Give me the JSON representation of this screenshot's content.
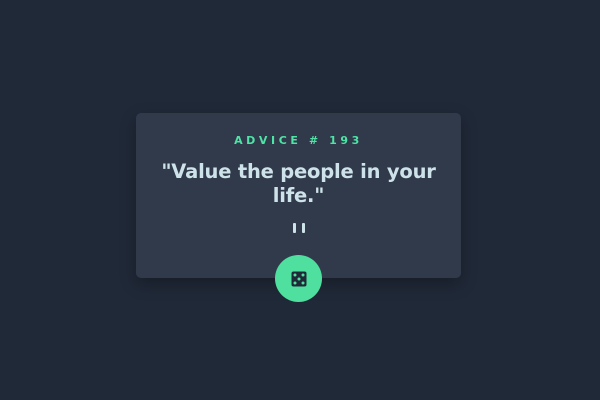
{
  "advice": {
    "label": "ADVICE # 193",
    "text": "\"Value the people in your life.\""
  },
  "colors": {
    "background": "#202938",
    "card": "#313a4b",
    "accent": "#4fe0a0",
    "text": "#cee3e9"
  },
  "icons": {
    "divider": "pause-divider-icon",
    "button": "dice-icon"
  }
}
